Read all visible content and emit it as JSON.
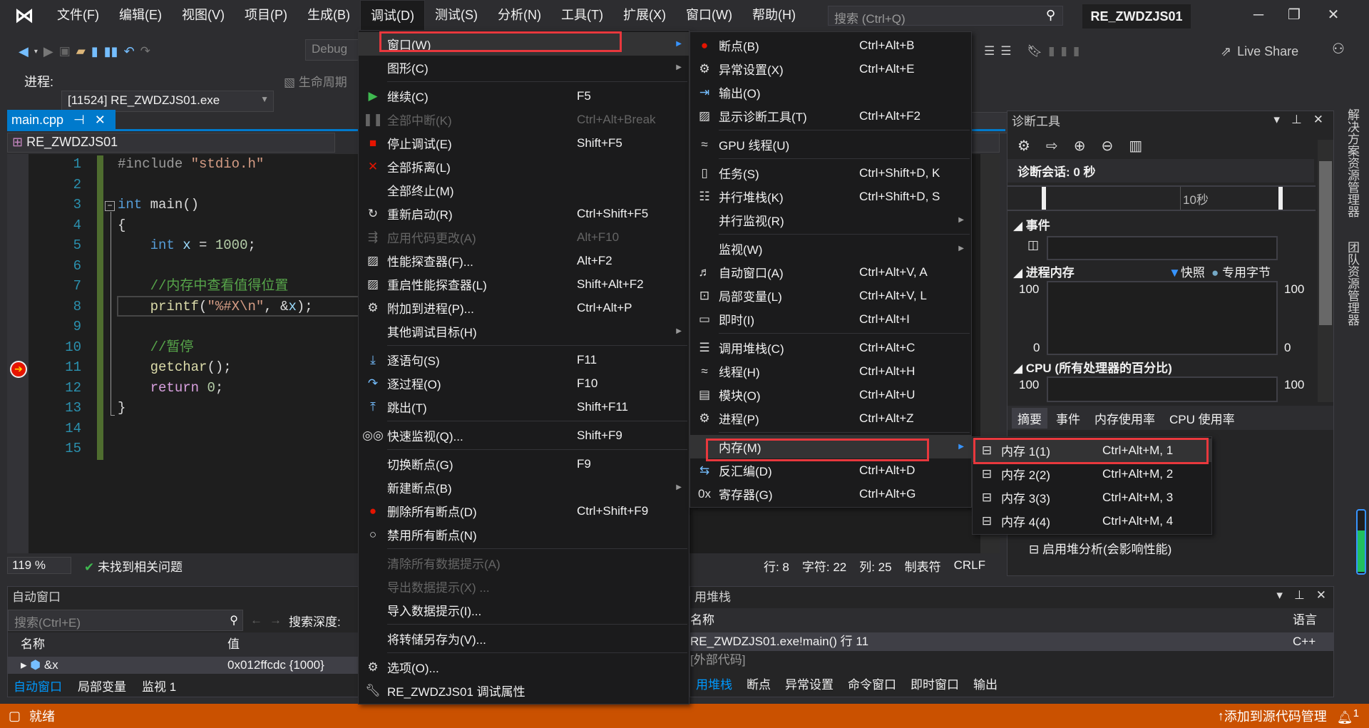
{
  "menubar": {
    "items": [
      "文件(F)",
      "编辑(E)",
      "视图(V)",
      "项目(P)",
      "生成(B)",
      "调试(D)",
      "测试(S)",
      "分析(N)",
      "工具(T)",
      "扩展(X)",
      "窗口(W)",
      "帮助(H)"
    ],
    "open_index": 5,
    "search_placeholder": "搜索 (Ctrl+Q)",
    "window_title": "RE_ZWDZJS01"
  },
  "toolbar": {
    "config": "Debug",
    "process_label": "进程:",
    "process_value": "[11524] RE_ZWDZJS01.exe",
    "lifecycle_label": "生命周期",
    "live_share": "Live Share"
  },
  "editor": {
    "tab": "main.cpp",
    "nav_project": "RE_ZWDZJS01",
    "line_numbers": [
      "1",
      "2",
      "3",
      "4",
      "5",
      "6",
      "7",
      "8",
      "9",
      "10",
      "11",
      "12",
      "13",
      "14",
      "15"
    ],
    "current_line": 11,
    "code": [
      [
        [
          "#include ",
          "pp"
        ],
        [
          "\"stdio.h\"",
          "str"
        ]
      ],
      [],
      [
        [
          "int",
          "kw"
        ],
        [
          " main()",
          ""
        ]
      ],
      [
        [
          "{",
          ""
        ]
      ],
      [
        [
          "    ",
          ""
        ],
        [
          "int",
          "kw"
        ],
        [
          " x",
          "var"
        ],
        [
          " = ",
          ""
        ],
        [
          "1000",
          "num"
        ],
        [
          ";",
          ""
        ]
      ],
      [],
      [
        [
          "    //内存中查看值得位置",
          "cm"
        ]
      ],
      [
        [
          "    ",
          ""
        ],
        [
          "printf",
          "fn"
        ],
        [
          "(",
          ""
        ],
        [
          "\"%#X\\n\"",
          "str"
        ],
        [
          ", &",
          ""
        ],
        [
          "x",
          "var"
        ],
        [
          ");",
          ""
        ]
      ],
      [],
      [
        [
          "    //暂停",
          "cm"
        ]
      ],
      [
        [
          "    ",
          ""
        ],
        [
          "getchar",
          "fn"
        ],
        [
          "();",
          ""
        ]
      ],
      [
        [
          "    ",
          ""
        ],
        [
          "return",
          "rt"
        ],
        [
          " ",
          ""
        ],
        [
          "0",
          "num"
        ],
        [
          ";",
          ""
        ]
      ],
      [
        [
          "}",
          ""
        ]
      ],
      [],
      []
    ],
    "zoom": "119 %",
    "issues": "未找到相关问题",
    "status": {
      "line": "行: 8",
      "char": "字符: 22",
      "col": "列: 25",
      "tabs": "制表符",
      "eol": "CRLF"
    }
  },
  "autos": {
    "title": "自动窗口",
    "search_placeholder": "搜索(Ctrl+E)",
    "search_depth": "搜索深度:",
    "columns": [
      "名称",
      "值"
    ],
    "rows": [
      {
        "name": "&x",
        "value": "0x012ffcdc {1000}"
      }
    ],
    "tabs": [
      "自动窗口",
      "局部变量",
      "监视 1"
    ]
  },
  "callstack": {
    "title": "用堆栈",
    "columns": [
      "名称",
      "语言"
    ],
    "rows": [
      {
        "name": "RE_ZWDZJS01.exe!main() 行 11",
        "lang": "C++"
      },
      {
        "name": "[外部代码]",
        "lang": ""
      }
    ],
    "tabs": [
      "用堆栈",
      "断点",
      "异常设置",
      "命令窗口",
      "即时窗口",
      "输出"
    ]
  },
  "diagnostics": {
    "title": "诊断工具",
    "session": "诊断会话: 0 秒",
    "timeline_label": "10秒",
    "events_label": "事件",
    "memory_label": "进程内存",
    "legend_snapshot": "快照",
    "legend_private": "专用字节",
    "mem_max": "100",
    "mem_min": "0",
    "cpu_label": "CPU (所有处理器的百分比)",
    "cpu_max": "100",
    "tabs": [
      "摘要",
      "事件",
      "内存使用率",
      "CPU 使用率"
    ],
    "heap_button": "启用堆分析(会影响性能)"
  },
  "side_tabs": [
    "解决方案资源管理器",
    "团队资源管理器"
  ],
  "statusbar": {
    "ready": "就绪",
    "source_control": "添加到源代码管理",
    "badge": "1"
  },
  "debug_menu": [
    {
      "label": "窗口(W)",
      "submenu": true,
      "highlight": true,
      "icon": ""
    },
    {
      "label": "图形(C)",
      "submenu": true,
      "icon": ""
    },
    {
      "sep": true
    },
    {
      "label": "继续(C)",
      "shortcut": "F5",
      "icon": "play-icon"
    },
    {
      "label": "全部中断(K)",
      "shortcut": "Ctrl+Alt+Break",
      "disabled": true,
      "icon": "pause-icon"
    },
    {
      "label": "停止调试(E)",
      "shortcut": "Shift+F5",
      "icon": "stop-icon"
    },
    {
      "label": "全部拆离(L)",
      "icon": "detach-icon"
    },
    {
      "label": "全部终止(M)",
      "icon": ""
    },
    {
      "label": "重新启动(R)",
      "shortcut": "Ctrl+Shift+F5",
      "icon": "restart-icon"
    },
    {
      "label": "应用代码更改(A)",
      "shortcut": "Alt+F10",
      "disabled": true,
      "icon": "apply-changes-icon"
    },
    {
      "label": "性能探查器(F)...",
      "shortcut": "Alt+F2",
      "icon": "profiler-icon"
    },
    {
      "label": "重启性能探查器(L)",
      "shortcut": "Shift+Alt+F2",
      "icon": "profiler-icon"
    },
    {
      "label": "附加到进程(P)...",
      "shortcut": "Ctrl+Alt+P",
      "icon": "attach-icon"
    },
    {
      "label": "其他调试目标(H)",
      "submenu": true,
      "icon": ""
    },
    {
      "sep": true
    },
    {
      "label": "逐语句(S)",
      "shortcut": "F11",
      "icon": "step-into-icon"
    },
    {
      "label": "逐过程(O)",
      "shortcut": "F10",
      "icon": "step-over-icon"
    },
    {
      "label": "跳出(T)",
      "shortcut": "Shift+F11",
      "icon": "step-out-icon"
    },
    {
      "sep": true
    },
    {
      "label": "快速监视(Q)...",
      "shortcut": "Shift+F9",
      "icon": "glasses-icon"
    },
    {
      "sep": true
    },
    {
      "label": "切换断点(G)",
      "shortcut": "F9",
      "icon": ""
    },
    {
      "label": "新建断点(B)",
      "submenu": true,
      "icon": ""
    },
    {
      "label": "删除所有断点(D)",
      "shortcut": "Ctrl+Shift+F9",
      "icon": "delete-breakpoints-icon"
    },
    {
      "label": "禁用所有断点(N)",
      "icon": "disable-breakpoints-icon"
    },
    {
      "sep": true
    },
    {
      "label": "清除所有数据提示(A)",
      "disabled": true,
      "icon": ""
    },
    {
      "label": "导出数据提示(X) ...",
      "disabled": true,
      "icon": ""
    },
    {
      "label": "导入数据提示(I)...",
      "icon": ""
    },
    {
      "sep": true
    },
    {
      "label": "将转储另存为(V)...",
      "icon": ""
    },
    {
      "sep": true
    },
    {
      "label": "选项(O)...",
      "icon": "gear-icon"
    },
    {
      "label": "RE_ZWDZJS01 调试属性",
      "icon": "wrench-icon"
    }
  ],
  "window_submenu": [
    {
      "label": "断点(B)",
      "shortcut": "Ctrl+Alt+B",
      "icon": "breakpoint-icon"
    },
    {
      "label": "异常设置(X)",
      "shortcut": "Ctrl+Alt+E",
      "icon": "exception-icon"
    },
    {
      "label": "输出(O)",
      "icon": "output-icon"
    },
    {
      "label": "显示诊断工具(T)",
      "shortcut": "Ctrl+Alt+F2",
      "icon": "diagnostics-icon"
    },
    {
      "sep": true
    },
    {
      "label": "GPU 线程(U)",
      "icon": "gpu-threads-icon"
    },
    {
      "sep": true
    },
    {
      "label": "任务(S)",
      "shortcut": "Ctrl+Shift+D, K",
      "icon": "tasks-icon"
    },
    {
      "label": "并行堆栈(K)",
      "shortcut": "Ctrl+Shift+D, S",
      "icon": "parallel-stacks-icon"
    },
    {
      "label": "并行监视(R)",
      "submenu": true,
      "icon": ""
    },
    {
      "sep": true
    },
    {
      "label": "监视(W)",
      "submenu": true,
      "icon": ""
    },
    {
      "label": "自动窗口(A)",
      "shortcut": "Ctrl+Alt+V, A",
      "icon": "autos-icon"
    },
    {
      "label": "局部变量(L)",
      "shortcut": "Ctrl+Alt+V, L",
      "icon": "locals-icon"
    },
    {
      "label": "即时(I)",
      "shortcut": "Ctrl+Alt+I",
      "icon": "immediate-icon"
    },
    {
      "sep": true
    },
    {
      "label": "调用堆栈(C)",
      "shortcut": "Ctrl+Alt+C",
      "icon": "call-stack-icon"
    },
    {
      "label": "线程(H)",
      "shortcut": "Ctrl+Alt+H",
      "icon": "threads-icon"
    },
    {
      "label": "模块(O)",
      "shortcut": "Ctrl+Alt+U",
      "icon": "modules-icon"
    },
    {
      "label": "进程(P)",
      "shortcut": "Ctrl+Alt+Z",
      "icon": "processes-icon"
    },
    {
      "sep": true
    },
    {
      "label": "内存(M)",
      "submenu": true,
      "highlight": true,
      "icon": ""
    },
    {
      "label": "反汇编(D)",
      "shortcut": "Ctrl+Alt+D",
      "icon": "disassembly-icon"
    },
    {
      "label": "寄存器(G)",
      "shortcut": "Ctrl+Alt+G",
      "icon": "registers-icon"
    }
  ],
  "memory_submenu": [
    {
      "label": "内存 1(1)",
      "shortcut": "Ctrl+Alt+M, 1",
      "icon": "memory-chip-icon",
      "highlight": true
    },
    {
      "label": "内存 2(2)",
      "shortcut": "Ctrl+Alt+M, 2",
      "icon": "memory-chip-icon"
    },
    {
      "label": "内存 3(3)",
      "shortcut": "Ctrl+Alt+M, 3",
      "icon": "memory-chip-icon"
    },
    {
      "label": "内存 4(4)",
      "shortcut": "Ctrl+Alt+M, 4",
      "icon": "memory-chip-icon"
    }
  ],
  "colors": {
    "accent": "#007acc",
    "status_bar": "#ca5100",
    "highlight_box": "#e8383d",
    "menu_bg": "#1b1b1c"
  }
}
